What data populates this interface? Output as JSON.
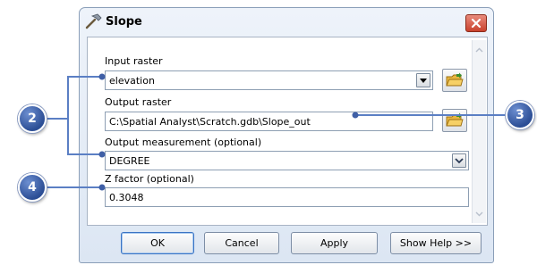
{
  "dialog": {
    "title": "Slope",
    "close_icon": "close-x-icon",
    "title_icon": "hammer-icon"
  },
  "form": {
    "input_raster_label": "Input raster",
    "input_raster_value": "elevation",
    "output_raster_label": "Output raster",
    "output_raster_value": "C:\\Spatial Analyst\\Scratch.gdb\\Slope_out",
    "output_measurement_label": "Output measurement (optional)",
    "output_measurement_value": "DEGREE",
    "z_factor_label": "Z factor (optional)",
    "z_factor_value": "0.3048"
  },
  "buttons": {
    "ok": "OK",
    "cancel": "Cancel",
    "apply": "Apply",
    "show_help": "Show Help >>"
  },
  "callouts": {
    "c2": "2",
    "c3": "3",
    "c4": "4"
  },
  "colors": {
    "callout": "#2c4e95",
    "leader_line": "#5b7fc4",
    "close_button": "#c9422d"
  }
}
